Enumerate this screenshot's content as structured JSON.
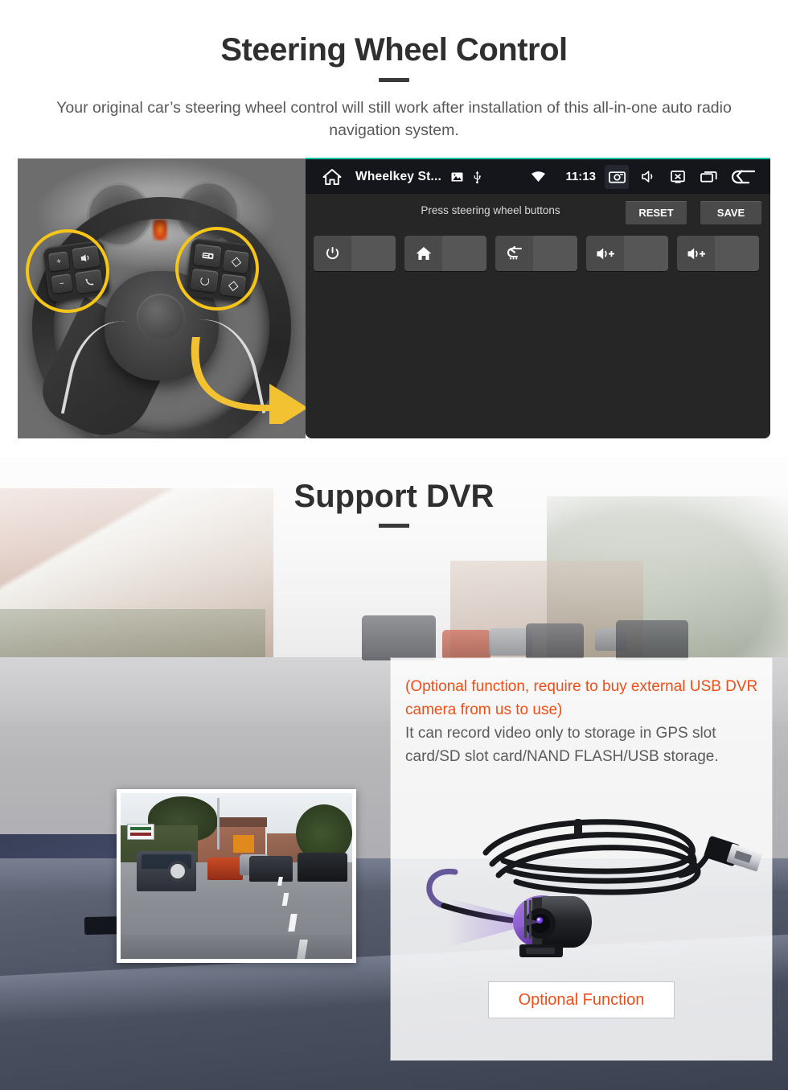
{
  "section1": {
    "title": "Steering Wheel Control",
    "subtitle": "Your original car’s steering wheel control will still work after installation of this all-in-one auto radio navigation system.",
    "headunit": {
      "status_bar": {
        "home_icon": "home-icon",
        "app_name": "Wheelkey St...",
        "image_icon": "image-icon",
        "usb_icon": "usb-icon",
        "wifi_icon": "wifi-icon",
        "clock": "11:13",
        "screenshot_icon": "screenshot-icon",
        "mute_icon": "mute-icon",
        "screen_off_icon": "screen-off-icon",
        "recents_icon": "recents-icon",
        "back_icon": "back-icon"
      },
      "toolbar": {
        "hint": "Press steering wheel buttons",
        "reset_label": "RESET",
        "save_label": "SAVE"
      },
      "keys": [
        {
          "icon": "power-icon"
        },
        {
          "icon": "home-icon"
        },
        {
          "icon": "back-icon"
        },
        {
          "icon": "volume-up-icon"
        },
        {
          "icon": "volume-up-icon"
        }
      ]
    },
    "wheel_photo": {
      "left_pad_keys": [
        "volume-plus",
        "volume-minus",
        "mode-icon",
        "phone-icon"
      ],
      "right_pad_keys": [
        "media-icon",
        "ring-icon",
        "diamond-up-icon",
        "diamond-down-icon"
      ],
      "highlight_color": "#f5c518",
      "arrow_color": "#f2c233"
    }
  },
  "section2": {
    "title": "Support DVR",
    "panel": {
      "highlight": "(Optional function, require to buy external USB DVR camera from us to use)",
      "body": "It can record video only to storage in GPS slot card/SD slot card/NAND FLASH/USB storage.",
      "button_label": "Optional Function"
    }
  },
  "colors": {
    "heading": "#2f2f2f",
    "body_text": "#5b5b5b",
    "accent_orange": "#f04e17",
    "accent_teal": "#19c6a5",
    "highlight_yellow": "#f5c518"
  }
}
